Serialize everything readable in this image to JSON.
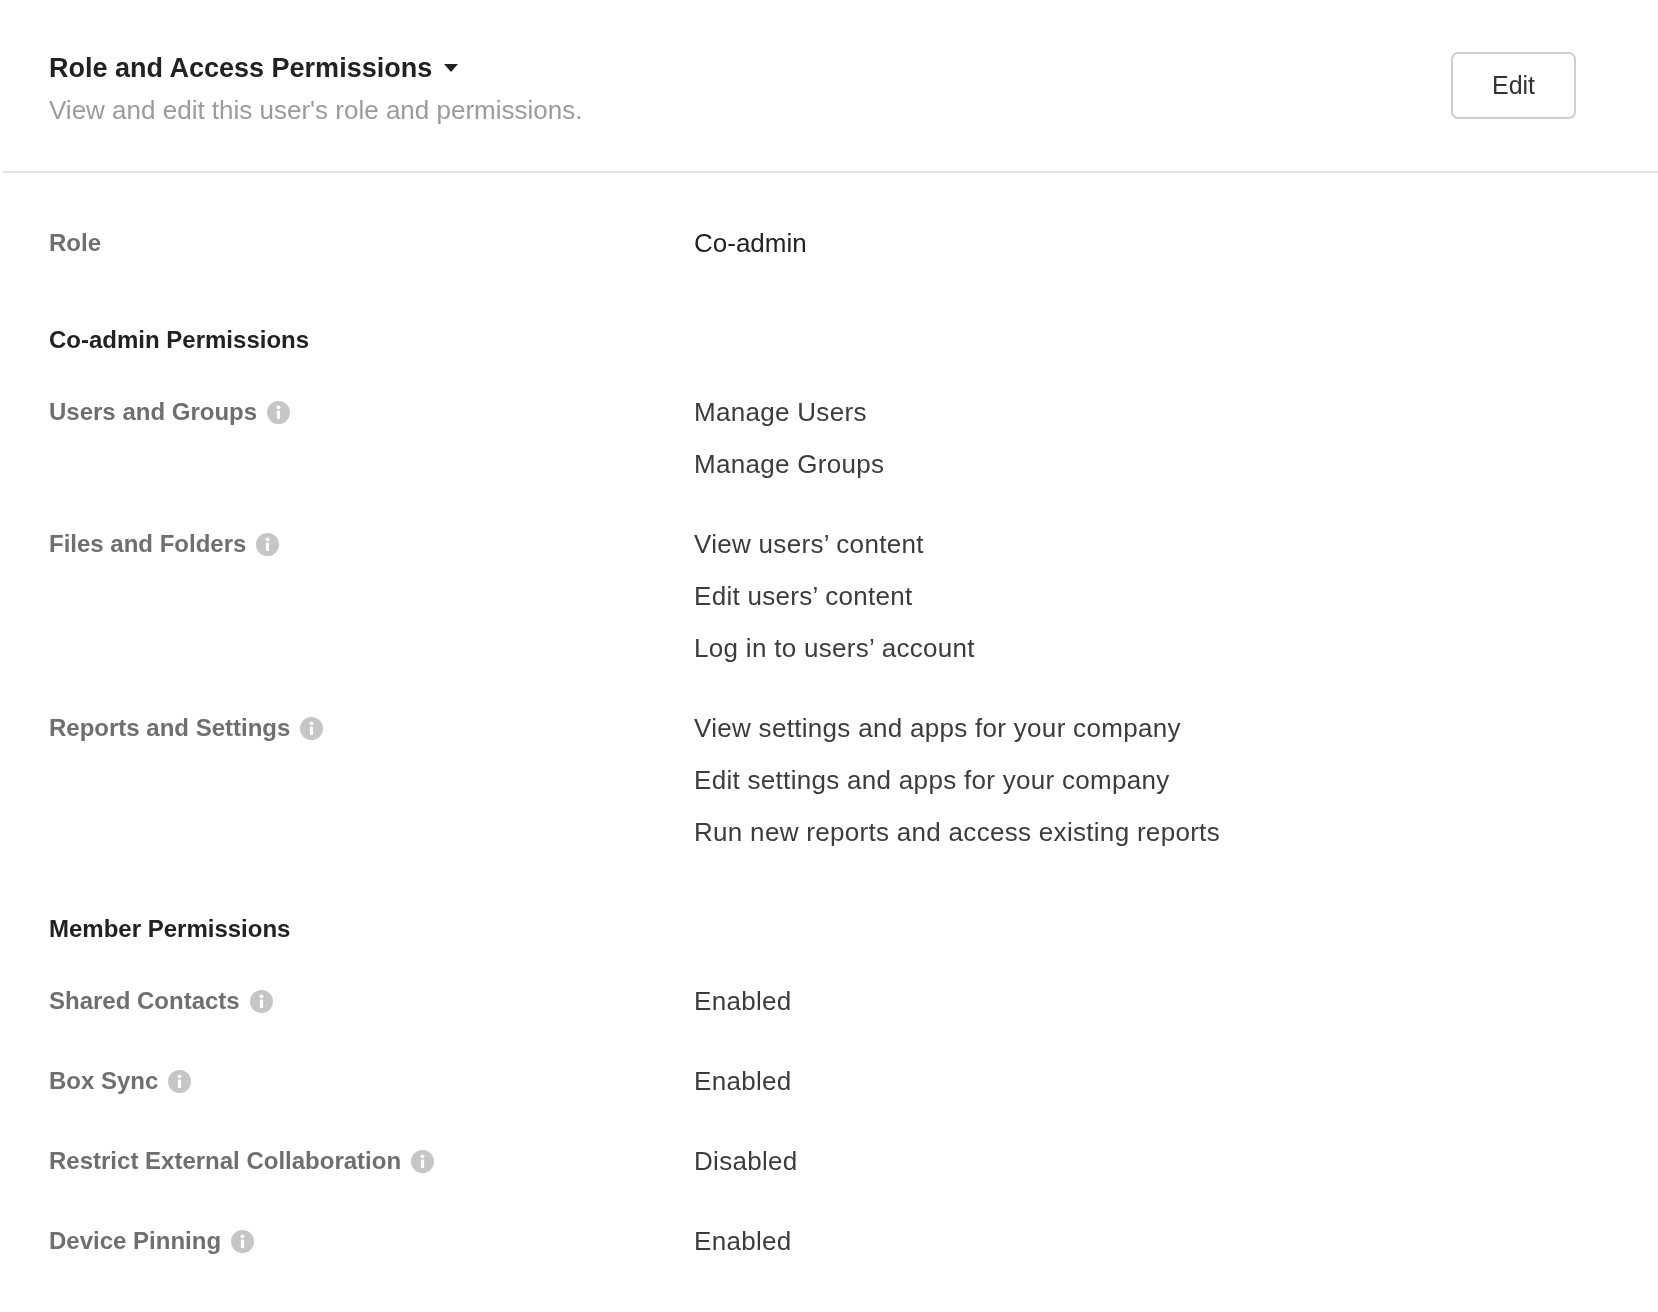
{
  "header": {
    "title": "Role and Access Permissions",
    "description": "View and edit this user's role and permissions.",
    "edit_button": "Edit"
  },
  "role": {
    "label": "Role",
    "value": "Co-admin"
  },
  "sections": [
    {
      "title": "Co-admin Permissions",
      "rows": [
        {
          "label": "Users and Groups",
          "values": [
            "Manage Users",
            "Manage Groups"
          ]
        },
        {
          "label": "Files and Folders",
          "values": [
            "View users’ content",
            "Edit users’ content",
            "Log in to users’ account"
          ]
        },
        {
          "label": "Reports and Settings",
          "values": [
            "View settings and apps for your company",
            "Edit settings and apps for your company",
            "Run new reports and access existing reports"
          ]
        }
      ]
    },
    {
      "title": "Member Permissions",
      "rows": [
        {
          "label": "Shared Contacts",
          "values": [
            "Enabled"
          ]
        },
        {
          "label": "Box Sync",
          "values": [
            "Enabled"
          ]
        },
        {
          "label": "Restrict External Collaboration",
          "values": [
            "Disabled"
          ]
        },
        {
          "label": "Device Pinning",
          "values": [
            "Enabled"
          ]
        }
      ]
    }
  ]
}
